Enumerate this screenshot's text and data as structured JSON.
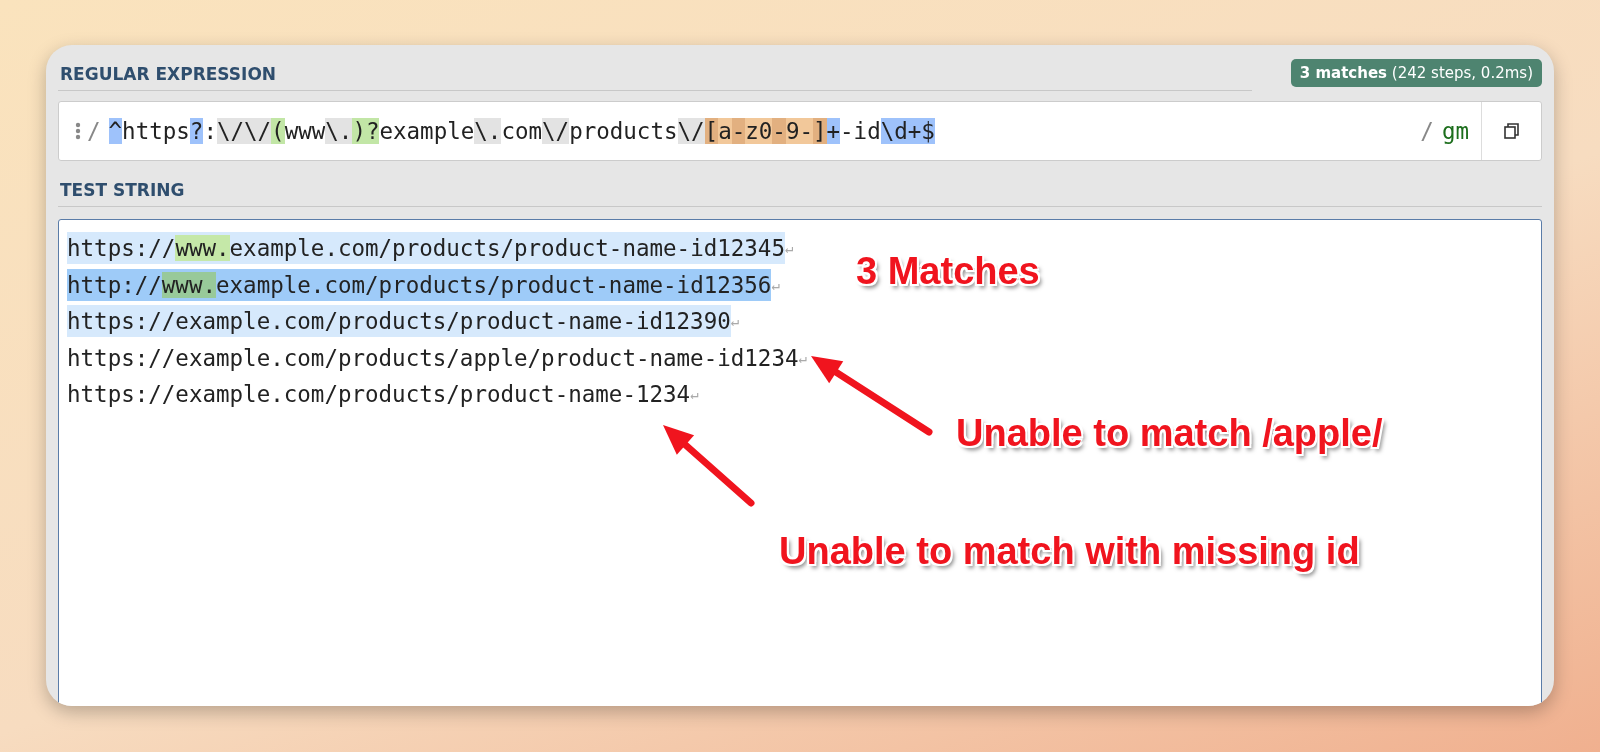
{
  "regex": {
    "title": "REGULAR EXPRESSION",
    "badge": "**3 matches** (242 steps, 0.2ms)",
    "open_delimiter": "/",
    "close_delimiter": "/",
    "flags": "gm",
    "tokens": [
      {
        "text": "^",
        "kind": "meta"
      },
      {
        "text": "https",
        "kind": "plain"
      },
      {
        "text": "?",
        "kind": "meta"
      },
      {
        "text": ":",
        "kind": "plain"
      },
      {
        "text": "\\/",
        "kind": "escape"
      },
      {
        "text": "\\/",
        "kind": "escape"
      },
      {
        "text": "(",
        "kind": "group"
      },
      {
        "text": "www",
        "kind": "plain"
      },
      {
        "text": "\\.",
        "kind": "escape"
      },
      {
        "text": ")?",
        "kind": "group"
      },
      {
        "text": "example",
        "kind": "plain"
      },
      {
        "text": "\\.",
        "kind": "escape"
      },
      {
        "text": "com",
        "kind": "plain"
      },
      {
        "text": "\\/",
        "kind": "escape"
      },
      {
        "text": "products",
        "kind": "plain"
      },
      {
        "text": "\\/",
        "kind": "escape"
      },
      {
        "text": "[",
        "kind": "set-edge"
      },
      {
        "text": "a",
        "kind": "set"
      },
      {
        "text": "-",
        "kind": "set-edge"
      },
      {
        "text": "z0",
        "kind": "set"
      },
      {
        "text": "-",
        "kind": "set-edge"
      },
      {
        "text": "9-",
        "kind": "set"
      },
      {
        "text": "]",
        "kind": "set-edge"
      },
      {
        "text": "+",
        "kind": "meta"
      },
      {
        "text": "-id",
        "kind": "plain"
      },
      {
        "text": "\\d+$",
        "kind": "meta"
      }
    ]
  },
  "test": {
    "title": "TEST STRING",
    "lines": [
      {
        "matched": true,
        "selected": false,
        "eol": "↵",
        "segments": [
          {
            "text": "https://",
            "group": false
          },
          {
            "text": "www.",
            "group": true
          },
          {
            "text": "example.com/products/product-name-id12345",
            "group": false
          }
        ]
      },
      {
        "matched": true,
        "selected": true,
        "eol": "↵",
        "segments": [
          {
            "text": "http://",
            "group": false
          },
          {
            "text": "www.",
            "group": true
          },
          {
            "text": "example.com/products/product-name-id12356",
            "group": false
          }
        ]
      },
      {
        "matched": true,
        "selected": false,
        "eol": "↵",
        "segments": [
          {
            "text": "https://example.com/products/product-name-id12390",
            "group": false
          }
        ]
      },
      {
        "matched": false,
        "selected": false,
        "eol": "↵",
        "segments": [
          {
            "text": "https://example.com/products/apple/product-name-id1234",
            "group": false
          }
        ]
      },
      {
        "matched": false,
        "selected": false,
        "eol": "↵",
        "segments": [
          {
            "text": "https://example.com/products/product-name-1234",
            "group": false
          }
        ]
      }
    ]
  },
  "annotations": [
    {
      "text": "3 Matches"
    },
    {
      "text": "Unable to match /apple/"
    },
    {
      "text": "Unable to match with missing id"
    }
  ]
}
